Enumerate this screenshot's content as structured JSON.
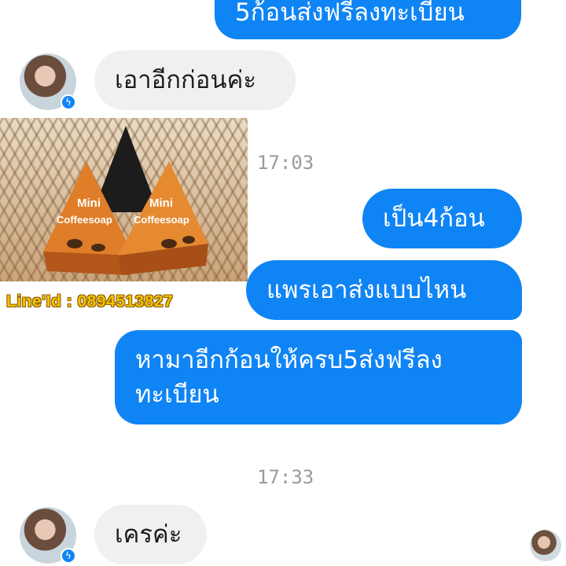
{
  "messages": {
    "m1": "5ก้อนส่งฟรีลงทะเบียน",
    "m2": "เอาอีกก่อนค่ะ",
    "m3": "เป็น4ก้อน",
    "m4": "แพรเอาส่งแบบไหน",
    "m5_line1": "หามาอีกก้อนให้ครบ5ส่งฟรีลง",
    "m5_line2": "ทะเบียน",
    "m6": "เครค่ะ"
  },
  "timestamps": {
    "t1": "17:03",
    "t2": "17:33"
  },
  "photo": {
    "brand_text": "Mini",
    "product_text": "Coffeesoap",
    "caption": "Line'Id : 0894513827"
  },
  "icons": {
    "messenger_badge": "messenger-icon"
  },
  "colors": {
    "outgoing": "#0f84f5",
    "incoming": "#f1f0f0",
    "timestamp": "#9a9a9a"
  }
}
